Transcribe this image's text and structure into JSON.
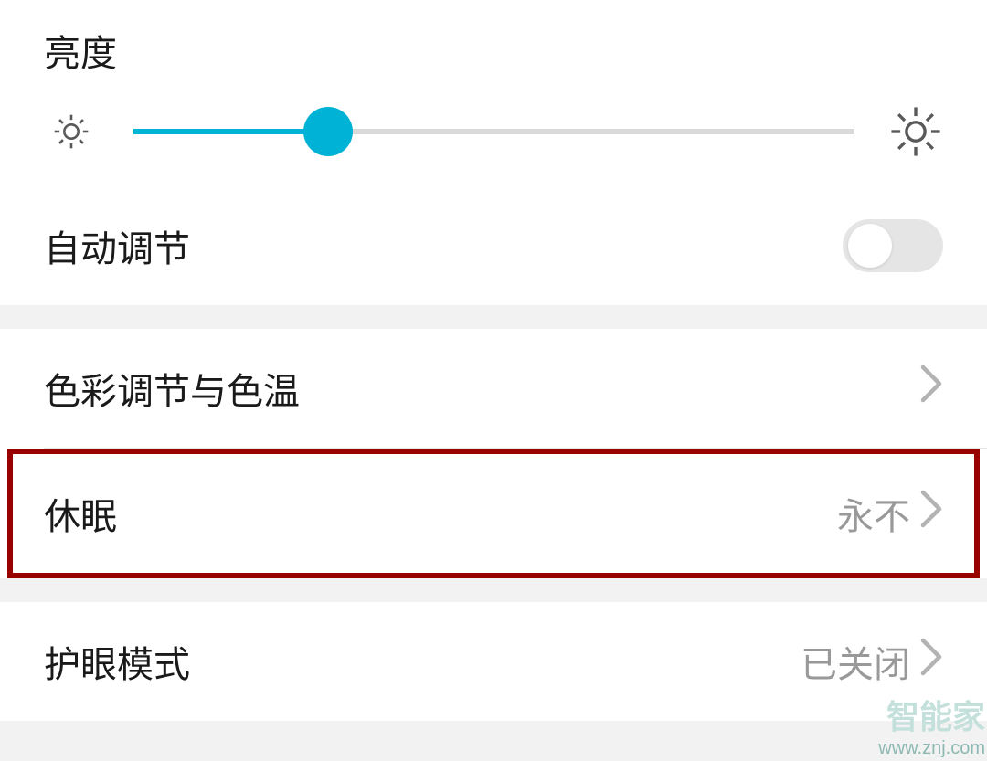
{
  "brightness": {
    "title": "亮度",
    "icon_low": "brightness-low-icon",
    "icon_high": "brightness-high-icon",
    "slider_percent": 27
  },
  "auto_adjust": {
    "label": "自动调节",
    "enabled": false
  },
  "color_temp": {
    "label": "色彩调节与色温"
  },
  "sleep": {
    "label": "休眠",
    "value": "永不"
  },
  "eye_comfort": {
    "label": "护眼模式",
    "value": "已关闭"
  },
  "watermark": {
    "main": "智能家",
    "url": "www.znj.com"
  }
}
